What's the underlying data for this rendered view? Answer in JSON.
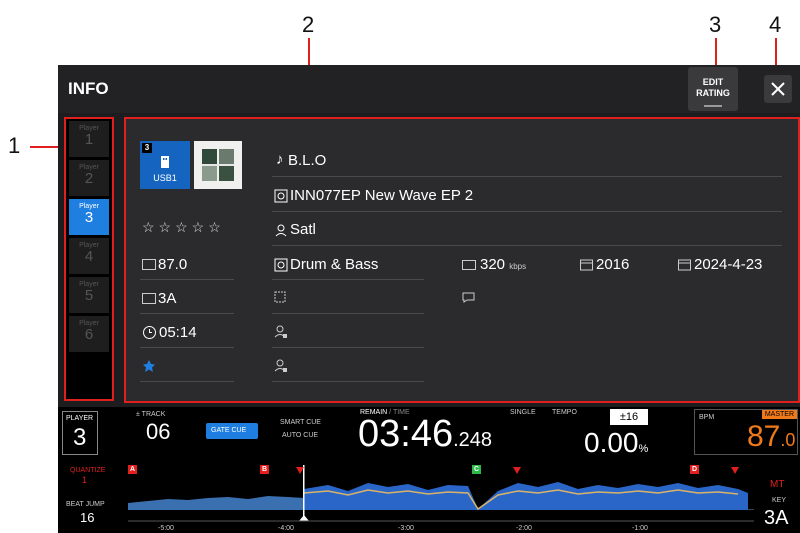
{
  "callouts": [
    "1",
    "2",
    "3",
    "4"
  ],
  "header": {
    "title": "INFO",
    "edit_rating_line1": "EDIT",
    "edit_rating_line2": "RATING"
  },
  "players": [
    {
      "label": "Player",
      "num": "1"
    },
    {
      "label": "Player",
      "num": "2"
    },
    {
      "label": "Player",
      "num": "3"
    },
    {
      "label": "Player",
      "num": "4"
    },
    {
      "label": "Player",
      "num": "5"
    },
    {
      "label": "Player",
      "num": "6"
    }
  ],
  "active_player_index": 2,
  "track": {
    "source_badge": "3",
    "source": "USB1",
    "title": "B.L.O",
    "album": "INN077EP New Wave EP 2",
    "artist": "Satl",
    "rating_stars": "☆☆☆☆☆",
    "bpm": "87.0",
    "genre": "Drum & Bass",
    "bitrate": "320",
    "bitrate_unit": "kbps",
    "year": "2016",
    "date_added": "2024-4-23",
    "key": "3A",
    "time": "05:14"
  },
  "deck": {
    "player_label": "PLAYER",
    "player_num": "3",
    "track_label": "TRACK",
    "track_num": "06",
    "gate_cue": "GATE CUE",
    "smart_cue": "SMART CUE",
    "auto_cue": "AUTO CUE",
    "remain_label": "REMAIN",
    "time_label": " / TIME",
    "remain_main": "03:46",
    "remain_ms": ".248",
    "single": "SINGLE",
    "tempo_label": "TEMPO",
    "tempo_range": "±16",
    "tempo_main": "0.00",
    "tempo_unit": "%",
    "bpm_label": "BPM",
    "master": "MASTER",
    "bpm_main": "87",
    "bpm_dec": ".0",
    "quantize_label": "QUANTIZE",
    "quantize_val": "1",
    "beat_jump_label": "BEAT JUMP",
    "beat_jump_val": "16",
    "mt": "MT",
    "key_label": "KEY",
    "key_val": "3A",
    "cue_markers": [
      "A",
      "B",
      "C",
      "D"
    ],
    "time_ticks": [
      "-5:00",
      "-4:00",
      "-3:00",
      "-2:00",
      "-1:00"
    ]
  },
  "colors": {
    "accent_blue": "#1f7fe0",
    "callout_red": "#e0201f",
    "bpm_orange": "#f07a1a"
  }
}
